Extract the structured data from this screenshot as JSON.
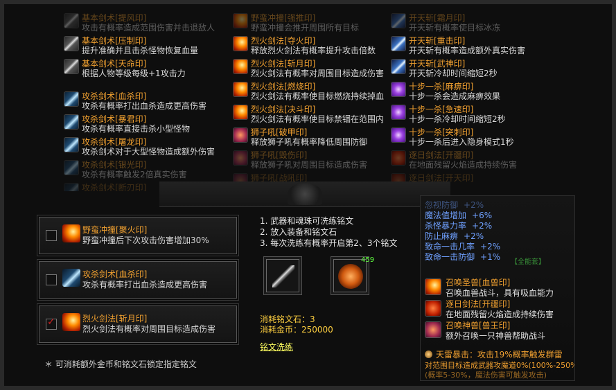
{
  "top_columns": [
    {
      "skills": [
        {
          "name": "基本剑术[提风印]",
          "desc": "攻击有概率造成范围伤害并击退敌人",
          "icon": "sword-icon",
          "style": "dim"
        },
        {
          "name": "基本剑术[压制印]",
          "desc": "提升准确并且击杀怪物恢复血量",
          "icon": "sword-icon",
          "style": ""
        },
        {
          "name": "基本剑术[天命印]",
          "desc": "根据人物等级每级+1攻击力",
          "icon": "sword-icon",
          "style": ""
        },
        {
          "name": "",
          "desc": "",
          "icon": "",
          "style": "spacer"
        },
        {
          "name": "攻杀剑术[血杀印]",
          "desc": "攻杀有概率打出血杀造成更高伤害",
          "icon": "blade-icon",
          "style": ""
        },
        {
          "name": "攻杀剑术[暴君印]",
          "desc": "攻杀有概率直接击杀小型怪物",
          "icon": "blade-icon",
          "style": ""
        },
        {
          "name": "攻杀剑术[屠龙印]",
          "desc": "攻杀剑术对于大型怪物造成额外伤害",
          "icon": "blade-icon",
          "style": ""
        },
        {
          "name": "攻杀剑术[银光印]",
          "desc": "攻杀有概率触发2倍真实伤害",
          "icon": "blade-icon",
          "style": "dim"
        },
        {
          "name": "攻杀剑术[断刃印]",
          "desc": "",
          "icon": "blade-icon",
          "style": "dim2"
        }
      ]
    },
    {
      "skills": [
        {
          "name": "野蛮冲撞[强推印]",
          "desc": "野蛮冲撞会推开周围所有目标",
          "icon": "fire-icon",
          "style": "dim"
        },
        {
          "name": "烈火剑法[夺火印]",
          "desc": "释放烈火剑法有概率提升攻击倍数",
          "icon": "fire-icon",
          "style": ""
        },
        {
          "name": "烈火剑法[斩月印]",
          "desc": "烈火剑法有概率对周围目标造成伤害",
          "icon": "fire-icon",
          "style": ""
        },
        {
          "name": "烈火剑法[燃烧印]",
          "desc": "烈火剑法有概率使目标燃烧持续掉血",
          "icon": "fire-icon",
          "style": ""
        },
        {
          "name": "烈火剑法[决斗印]",
          "desc": "烈火剑法有概率使目标禁锢在范围内",
          "icon": "fire-icon",
          "style": ""
        },
        {
          "name": "狮子吼[破甲印]",
          "desc": "释放狮子吼有概率降低周围防御",
          "icon": "lion-icon",
          "style": ""
        },
        {
          "name": "狮子吼[毁伤印]",
          "desc": "释放狮子吼对周围目标造成伤害",
          "icon": "lion-icon",
          "style": "dim"
        },
        {
          "name": "狮子吼[战吼印]",
          "desc": "释放狮子吼有概率提升周围攻击速度",
          "icon": "lion-icon",
          "style": "dim2"
        }
      ]
    },
    {
      "skills": [
        {
          "name": "开天斩[霜月印]",
          "desc": "开天斩有概率使目标冰冻",
          "icon": "ice-icon",
          "style": "dim"
        },
        {
          "name": "开天斩[重击印]",
          "desc": "开天斩有概率造成额外真实伤害",
          "icon": "ice-icon",
          "style": ""
        },
        {
          "name": "开天斩[武神印]",
          "desc": "开天斩冷却时间缩短2秒",
          "icon": "ice-icon",
          "style": ""
        },
        {
          "name": "十步一杀[麻痹印]",
          "desc": "十步一杀会造成麻痹效果",
          "icon": "purple-icon",
          "style": ""
        },
        {
          "name": "十步一杀[急速印]",
          "desc": "十步一杀冷却时间缩短2秒",
          "icon": "purple-icon",
          "style": ""
        },
        {
          "name": "十步一杀[突刺印]",
          "desc": "十步一杀后进入隐身模式1秒",
          "icon": "purple-icon",
          "style": ""
        },
        {
          "name": "逐日剑法[开疆印]",
          "desc": "在地面残留火焰造成持续伤害",
          "icon": "red-icon",
          "style": "dim"
        },
        {
          "name": "逐日剑法[开天印]",
          "desc": "",
          "icon": "red-icon",
          "style": "dim2"
        }
      ]
    }
  ],
  "options": [
    {
      "name": "野蛮冲撞[聚火印]",
      "desc": "野蛮冲撞后下次攻击伤害增加30%",
      "icon": "fire-icon",
      "checked": false
    },
    {
      "name": "攻杀剑术[血杀印]",
      "desc": "攻杀有概率打出血杀造成更高伤害",
      "icon": "blade-icon",
      "checked": false
    },
    {
      "name": "烈火剑法[斩月印]",
      "desc": "烈火剑法有概率对周围目标造成伤害",
      "icon": "fire-icon",
      "checked": true
    }
  ],
  "note": "＊ 可消耗额外金币和铭文石锁定指定铭文",
  "instructions": [
    "1. 武器和魂珠可洗练铭文",
    "2. 放入装备和铭文石",
    "3. 每次洗练有概率开启第2、3个铭文"
  ],
  "slots": {
    "weapon_icon": "sword-icon",
    "stone_icon": "inscription-stone-icon",
    "stone_count": "459"
  },
  "costs": {
    "stone": "消耗铭文石：3",
    "gold": "消耗金币：250000"
  },
  "refine_link": "铭文洗练",
  "right_panel": {
    "stats": [
      {
        "k": "忽视防御",
        "v": "+2%",
        "dim": true
      },
      {
        "k": "魔法值增加",
        "v": "+6%"
      },
      {
        "k": "杀怪暴力率",
        "v": "+2%"
      },
      {
        "k": "防止麻痹",
        "v": "+2%"
      },
      {
        "k": "致命一击几率",
        "v": "+2%"
      },
      {
        "k": "致命一击防御",
        "v": "+1%"
      }
    ],
    "tag": "【全能套】",
    "skills": [
      {
        "name": "召唤圣兽[血兽印]",
        "desc": "召唤血兽战斗，具有吸血能力",
        "icon": "summon-icon"
      },
      {
        "name": "逐日剑法[开疆印]",
        "desc": "在地面残留火焰造成持续伤害",
        "icon": "red-icon"
      },
      {
        "name": "召唤神兽[兽王印]",
        "desc": "额外召唤一只神兽帮助战斗",
        "icon": "summon-icon"
      }
    ],
    "passive_title": "天雷暴击：攻击19%概率触发群雷",
    "passive_lines": [
      "对范围目标造成武器攻魔道0%(100%-250%)",
      "(概率5-30%，魔法伤害可触发攻击)"
    ]
  }
}
